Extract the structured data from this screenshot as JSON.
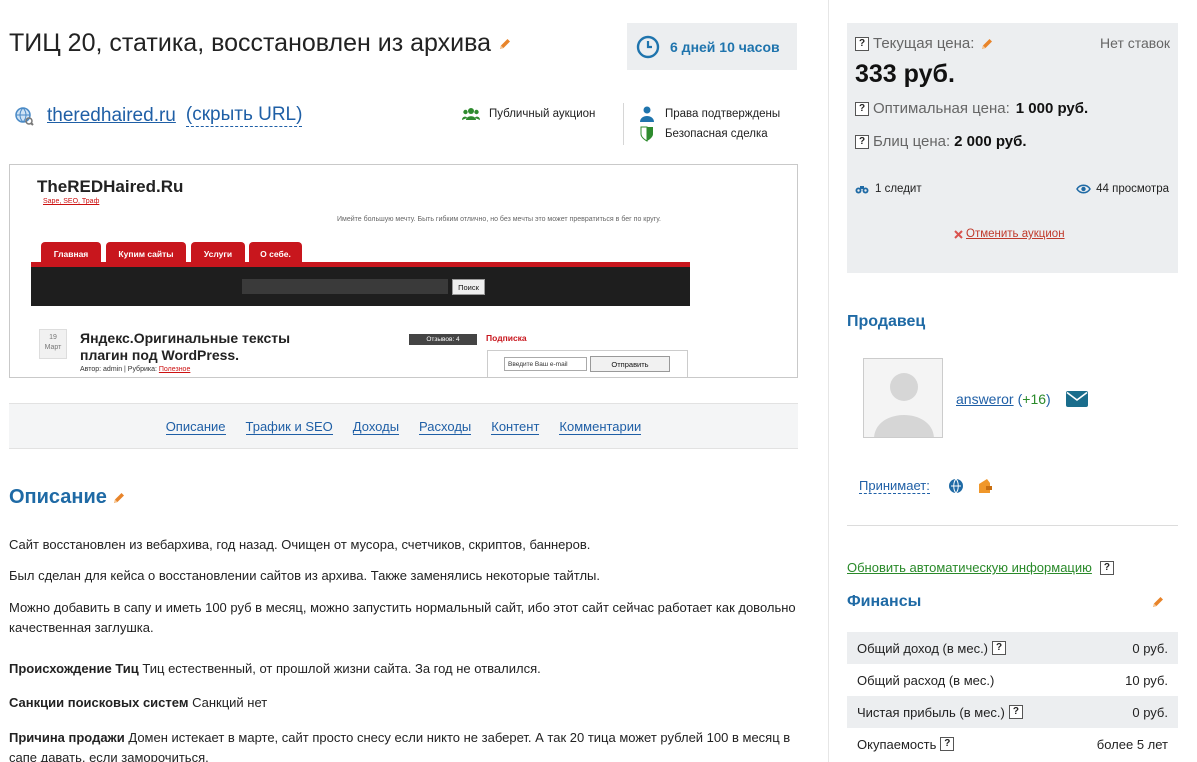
{
  "lot": {
    "title": "ТИЦ 20, статика, восстановлен из архива",
    "time_left": "6 дней 10 часов",
    "url": "theredhaired.ru",
    "hide_url": "(скрыть URL)",
    "badges": {
      "public": "Публичный аукцион",
      "rights": "Права подтверждены",
      "safe": "Безопасная сделка"
    }
  },
  "screenshot": {
    "logo": "TheREDHaired.Ru",
    "slogan": "Sape, SEO, Траф",
    "motto": "Имейте большую мечту. Быть гибким отлично, но без мечты это может превратиться в бег по кругу.",
    "menu": [
      "Главная",
      "Купим сайты",
      "Услуги",
      "О себе."
    ],
    "search_button": "Поиск",
    "date_day": "19",
    "date_month": "Март",
    "post_title": "Яндекс.Оригинальные тексты плагин под WordPress.",
    "author_prefix": "Автор: admin | Рубрика:",
    "author_category": "Полезное",
    "reviews": "Отзывов: 4",
    "subscribe": "Подписка",
    "email_placeholder": "Введите Ваш e-mail",
    "send_button": "Отправить"
  },
  "tabs": [
    "Описание",
    "Трафик и SEO",
    "Доходы",
    "Расходы",
    "Контент",
    "Комментарии"
  ],
  "description": {
    "heading": "Описание",
    "p1": "Сайт восстановлен из вебархива, год назад. Очищен от мусора, счетчиков, скриптов, баннеров.",
    "p2": "Был сделан для кейса о восстановлении сайтов из архива. Также заменялись некоторые тайтлы.",
    "p3": "Можно добавить в сапу и иметь 100 руб в месяц, можно запустить нормальный сайт, ибо этот сайт сейчас работает как довольно качественная заглушка.",
    "origin_label": "Происхождение Тиц",
    "origin_text": " Тиц естественный, от прошлой жизни сайта. За год не отвалился.",
    "sanctions_label": "Санкции поисковых систем",
    "sanctions_text": " Санкций нет",
    "reason_label": "Причина продажи",
    "reason_text": " Домен истекает в марте, сайт просто снесу если никто не заберет. А так 20 тица может рублей 100 в месяц в сапе давать, если заморочиться."
  },
  "pricing": {
    "current_label": "Текущая цена:",
    "no_bids": "Нет ставок",
    "current_price": "333 руб.",
    "optimal_label": "Оптимальная цена:",
    "optimal_price": "1 000 руб.",
    "blitz_label": "Блиц цена:",
    "blitz_price": "2 000 руб.",
    "watchers": "1 следит",
    "views": "44 просмотра",
    "cancel": "Отменить аукцион"
  },
  "seller": {
    "heading": "Продавец",
    "name": "answeror",
    "rating_open": "(",
    "rating": "+16",
    "rating_close": ")",
    "accepts_label": "Принимает:"
  },
  "update_link": "Обновить автоматическую информацию",
  "finance": {
    "heading": "Финансы",
    "rows": [
      {
        "label": "Общий доход (в мес.)",
        "value": "0 руб."
      },
      {
        "label": "Общий расход (в мес.)",
        "value": "10 руб."
      },
      {
        "label": "Чистая прибыль (в мес.)",
        "value": "0 руб."
      },
      {
        "label": "Окупаемость",
        "value": "более 5 лет"
      }
    ]
  },
  "colors": {
    "link": "#1f5fa6",
    "heading": "#1f6aa5",
    "edit_pencil": "#e8842a",
    "panel_bg": "#eceef0",
    "green": "#2a8a2a",
    "cancel_red": "#c0392b"
  },
  "icons": [
    "pencil-icon",
    "clock-icon",
    "globe-link-icon",
    "group-icon",
    "user-icon",
    "shield-icon",
    "binoculars-icon",
    "eye-icon",
    "cross-icon",
    "envelope-icon",
    "webmoney-icon",
    "yandex-money-icon",
    "help-icon"
  ]
}
